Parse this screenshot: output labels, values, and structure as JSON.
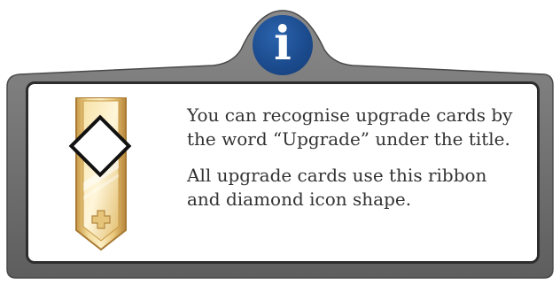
{
  "badge": {
    "glyph": "i",
    "icon": "info-icon",
    "color": "#1b4a8c"
  },
  "panel": {
    "paragraphs": [
      "You can recognise upgrade cards by the word “Upgrade” under the title.",
      "All upgrade cards use this ribbon and diamond icon shape."
    ]
  },
  "ribbon": {
    "icon": "upgrade-ribbon-diamond-icon",
    "colors": {
      "gold": "#e8c77a",
      "diamond": "#ffffff"
    }
  },
  "colors": {
    "frame": "#6b6b6b",
    "panel_border": "#2d2d2d",
    "text": "#333333"
  }
}
